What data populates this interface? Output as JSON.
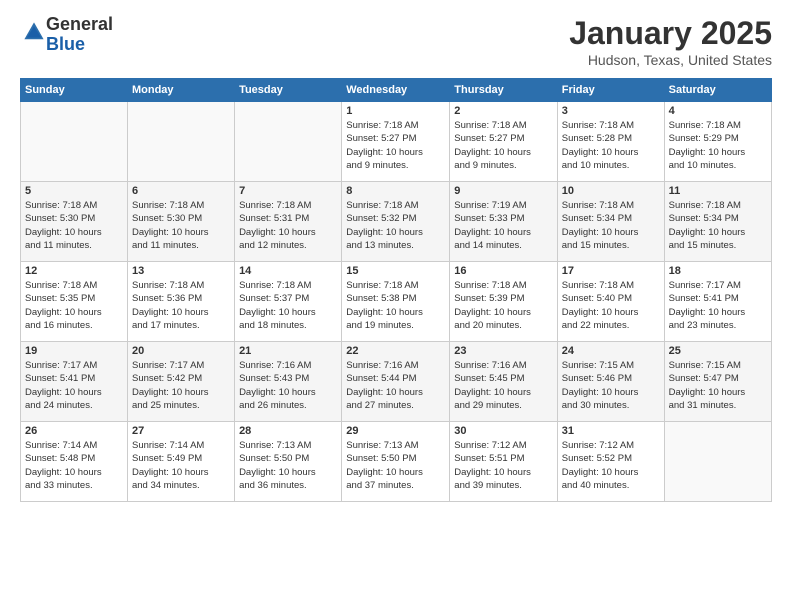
{
  "header": {
    "logo_general": "General",
    "logo_blue": "Blue",
    "title": "January 2025",
    "subtitle": "Hudson, Texas, United States"
  },
  "days_of_week": [
    "Sunday",
    "Monday",
    "Tuesday",
    "Wednesday",
    "Thursday",
    "Friday",
    "Saturday"
  ],
  "weeks": [
    [
      {
        "day": "",
        "content": ""
      },
      {
        "day": "",
        "content": ""
      },
      {
        "day": "",
        "content": ""
      },
      {
        "day": "1",
        "content": "Sunrise: 7:18 AM\nSunset: 5:27 PM\nDaylight: 10 hours\nand 9 minutes."
      },
      {
        "day": "2",
        "content": "Sunrise: 7:18 AM\nSunset: 5:27 PM\nDaylight: 10 hours\nand 9 minutes."
      },
      {
        "day": "3",
        "content": "Sunrise: 7:18 AM\nSunset: 5:28 PM\nDaylight: 10 hours\nand 10 minutes."
      },
      {
        "day": "4",
        "content": "Sunrise: 7:18 AM\nSunset: 5:29 PM\nDaylight: 10 hours\nand 10 minutes."
      }
    ],
    [
      {
        "day": "5",
        "content": "Sunrise: 7:18 AM\nSunset: 5:30 PM\nDaylight: 10 hours\nand 11 minutes."
      },
      {
        "day": "6",
        "content": "Sunrise: 7:18 AM\nSunset: 5:30 PM\nDaylight: 10 hours\nand 11 minutes."
      },
      {
        "day": "7",
        "content": "Sunrise: 7:18 AM\nSunset: 5:31 PM\nDaylight: 10 hours\nand 12 minutes."
      },
      {
        "day": "8",
        "content": "Sunrise: 7:18 AM\nSunset: 5:32 PM\nDaylight: 10 hours\nand 13 minutes."
      },
      {
        "day": "9",
        "content": "Sunrise: 7:19 AM\nSunset: 5:33 PM\nDaylight: 10 hours\nand 14 minutes."
      },
      {
        "day": "10",
        "content": "Sunrise: 7:18 AM\nSunset: 5:34 PM\nDaylight: 10 hours\nand 15 minutes."
      },
      {
        "day": "11",
        "content": "Sunrise: 7:18 AM\nSunset: 5:34 PM\nDaylight: 10 hours\nand 15 minutes."
      }
    ],
    [
      {
        "day": "12",
        "content": "Sunrise: 7:18 AM\nSunset: 5:35 PM\nDaylight: 10 hours\nand 16 minutes."
      },
      {
        "day": "13",
        "content": "Sunrise: 7:18 AM\nSunset: 5:36 PM\nDaylight: 10 hours\nand 17 minutes."
      },
      {
        "day": "14",
        "content": "Sunrise: 7:18 AM\nSunset: 5:37 PM\nDaylight: 10 hours\nand 18 minutes."
      },
      {
        "day": "15",
        "content": "Sunrise: 7:18 AM\nSunset: 5:38 PM\nDaylight: 10 hours\nand 19 minutes."
      },
      {
        "day": "16",
        "content": "Sunrise: 7:18 AM\nSunset: 5:39 PM\nDaylight: 10 hours\nand 20 minutes."
      },
      {
        "day": "17",
        "content": "Sunrise: 7:18 AM\nSunset: 5:40 PM\nDaylight: 10 hours\nand 22 minutes."
      },
      {
        "day": "18",
        "content": "Sunrise: 7:17 AM\nSunset: 5:41 PM\nDaylight: 10 hours\nand 23 minutes."
      }
    ],
    [
      {
        "day": "19",
        "content": "Sunrise: 7:17 AM\nSunset: 5:41 PM\nDaylight: 10 hours\nand 24 minutes."
      },
      {
        "day": "20",
        "content": "Sunrise: 7:17 AM\nSunset: 5:42 PM\nDaylight: 10 hours\nand 25 minutes."
      },
      {
        "day": "21",
        "content": "Sunrise: 7:16 AM\nSunset: 5:43 PM\nDaylight: 10 hours\nand 26 minutes."
      },
      {
        "day": "22",
        "content": "Sunrise: 7:16 AM\nSunset: 5:44 PM\nDaylight: 10 hours\nand 27 minutes."
      },
      {
        "day": "23",
        "content": "Sunrise: 7:16 AM\nSunset: 5:45 PM\nDaylight: 10 hours\nand 29 minutes."
      },
      {
        "day": "24",
        "content": "Sunrise: 7:15 AM\nSunset: 5:46 PM\nDaylight: 10 hours\nand 30 minutes."
      },
      {
        "day": "25",
        "content": "Sunrise: 7:15 AM\nSunset: 5:47 PM\nDaylight: 10 hours\nand 31 minutes."
      }
    ],
    [
      {
        "day": "26",
        "content": "Sunrise: 7:14 AM\nSunset: 5:48 PM\nDaylight: 10 hours\nand 33 minutes."
      },
      {
        "day": "27",
        "content": "Sunrise: 7:14 AM\nSunset: 5:49 PM\nDaylight: 10 hours\nand 34 minutes."
      },
      {
        "day": "28",
        "content": "Sunrise: 7:13 AM\nSunset: 5:50 PM\nDaylight: 10 hours\nand 36 minutes."
      },
      {
        "day": "29",
        "content": "Sunrise: 7:13 AM\nSunset: 5:50 PM\nDaylight: 10 hours\nand 37 minutes."
      },
      {
        "day": "30",
        "content": "Sunrise: 7:12 AM\nSunset: 5:51 PM\nDaylight: 10 hours\nand 39 minutes."
      },
      {
        "day": "31",
        "content": "Sunrise: 7:12 AM\nSunset: 5:52 PM\nDaylight: 10 hours\nand 40 minutes."
      },
      {
        "day": "",
        "content": ""
      }
    ]
  ]
}
